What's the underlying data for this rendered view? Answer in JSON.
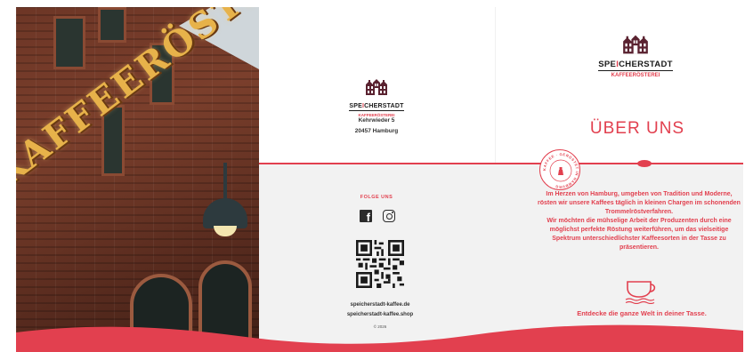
{
  "colors": {
    "accent": "#e2404f",
    "grey_panel": "#f2f2f2",
    "dark": "#1a1a1a"
  },
  "photo": {
    "sign_text": "KAFFEERÖSTEREI"
  },
  "logo": {
    "name_prefix": "SPE",
    "name_highlight": "I",
    "name_suffix": "CHERSTADT",
    "sub": "KAFFEERÖSTEREI"
  },
  "address": {
    "street": "Kehrwieder 5",
    "city": "20457 Hamburg"
  },
  "follow": {
    "label": "FOLGE UNS",
    "icons": [
      "facebook-icon",
      "instagram-icon"
    ]
  },
  "links": {
    "site": "speicherstadt-kaffee.de",
    "shop": "speicherstadt-kaffee.shop",
    "copyright": "© 2026"
  },
  "about": {
    "title": "ÜBER UNS",
    "paragraph_1": "Im Herzen von Hamburg, umgeben von Tradition und Moderne, rösten wir unsere Kaffees täglich in kleinen Chargen im schonenden Trommelröstverfahren.",
    "paragraph_2": "Wir möchten die mühselige Arbeit der Produzenten durch eine möglichst perfekte Röstung weiterführen, um das vielseitige Spektrum unterschiedlichster Kaffeesorten in der Tasse zu präsentieren.",
    "tagline": "Entdecke die ganze Welt in deiner Tasse."
  },
  "stamp": {
    "text": "KAFFEE · GERÖSTET IN HAMBURG"
  }
}
